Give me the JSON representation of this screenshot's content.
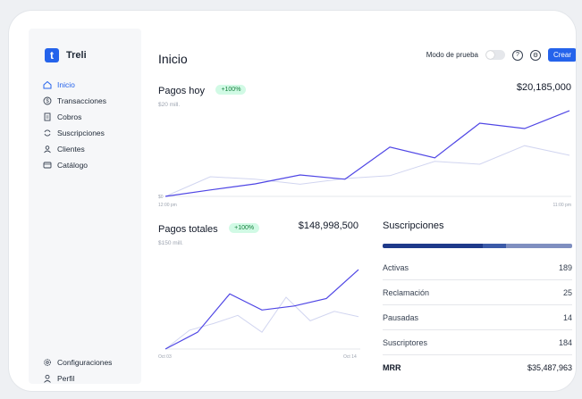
{
  "app": {
    "name": "Treli",
    "logo_letter": "t"
  },
  "sidebar": {
    "items": [
      {
        "label": "Inicio",
        "icon": "home-icon",
        "active": true
      },
      {
        "label": "Transacciones",
        "icon": "dollar-icon",
        "active": false
      },
      {
        "label": "Cobros",
        "icon": "document-icon",
        "active": false
      },
      {
        "label": "Suscripciones",
        "icon": "refresh-icon",
        "active": false
      },
      {
        "label": "Clientes",
        "icon": "users-icon",
        "active": false
      },
      {
        "label": "Catálogo",
        "icon": "catalog-icon",
        "active": false
      }
    ],
    "bottom": [
      {
        "label": "Configuraciones",
        "icon": "gear-icon"
      },
      {
        "label": "Perfil",
        "icon": "user-icon"
      }
    ]
  },
  "header": {
    "title": "Inicio",
    "test_mode_label": "Modo de prueba",
    "create_label": "Crear"
  },
  "pagos_hoy": {
    "title": "Pagos hoy",
    "badge": "+100%",
    "value": "$20,185,000",
    "y_top_label": "$20 mill.",
    "y_zero_label": "$0",
    "x_start": "12:00 pm",
    "x_end": "11:00 pm"
  },
  "pagos_totales": {
    "title": "Pagos totales",
    "badge": "+100%",
    "value": "$148,998,500",
    "y_top_label": "$150 mill.",
    "y_zero_label": "$0",
    "x_start": "Oct 03",
    "x_end": "Oct 14"
  },
  "suscripciones": {
    "title": "Suscripciones",
    "rows": [
      {
        "label": "Activas",
        "value": "189"
      },
      {
        "label": "Reclamación",
        "value": "25"
      },
      {
        "label": "Pausadas",
        "value": "14"
      },
      {
        "label": "Suscriptores",
        "value": "184"
      },
      {
        "label": "MRR",
        "value": "$35,487,963"
      }
    ],
    "bar_segments": [
      0.53,
      0.12,
      0.35
    ]
  },
  "colors": {
    "accent": "#2563eb",
    "line_primary": "#4f46e5",
    "line_secondary": "#d1d5f0"
  },
  "chart_data": [
    {
      "type": "line",
      "title": "Pagos hoy",
      "x": [
        0,
        1,
        2,
        3,
        4,
        5,
        6,
        7,
        8,
        9,
        10,
        11,
        12
      ],
      "series": [
        {
          "values": [
            0,
            1.8,
            3.5,
            6.0,
            4.8,
            13.8,
            10.8,
            20.5,
            19.0,
            24.0
          ]
        },
        {
          "values": [
            0,
            5.5,
            4.8,
            3.4,
            5.0,
            5.8,
            9.8,
            9.0,
            14.2,
            11.5
          ]
        }
      ],
      "ylim": [
        0,
        24
      ]
    },
    {
      "type": "line",
      "title": "Pagos totales",
      "x": [
        "Oct 03",
        "Oct 14"
      ],
      "series": [
        {
          "values": [
            0,
            25,
            82,
            58,
            64,
            75,
            118
          ]
        },
        {
          "values": [
            0,
            28,
            38,
            50,
            25,
            77,
            42,
            56,
            48
          ]
        }
      ],
      "ylim": [
        0,
        150
      ]
    }
  ]
}
